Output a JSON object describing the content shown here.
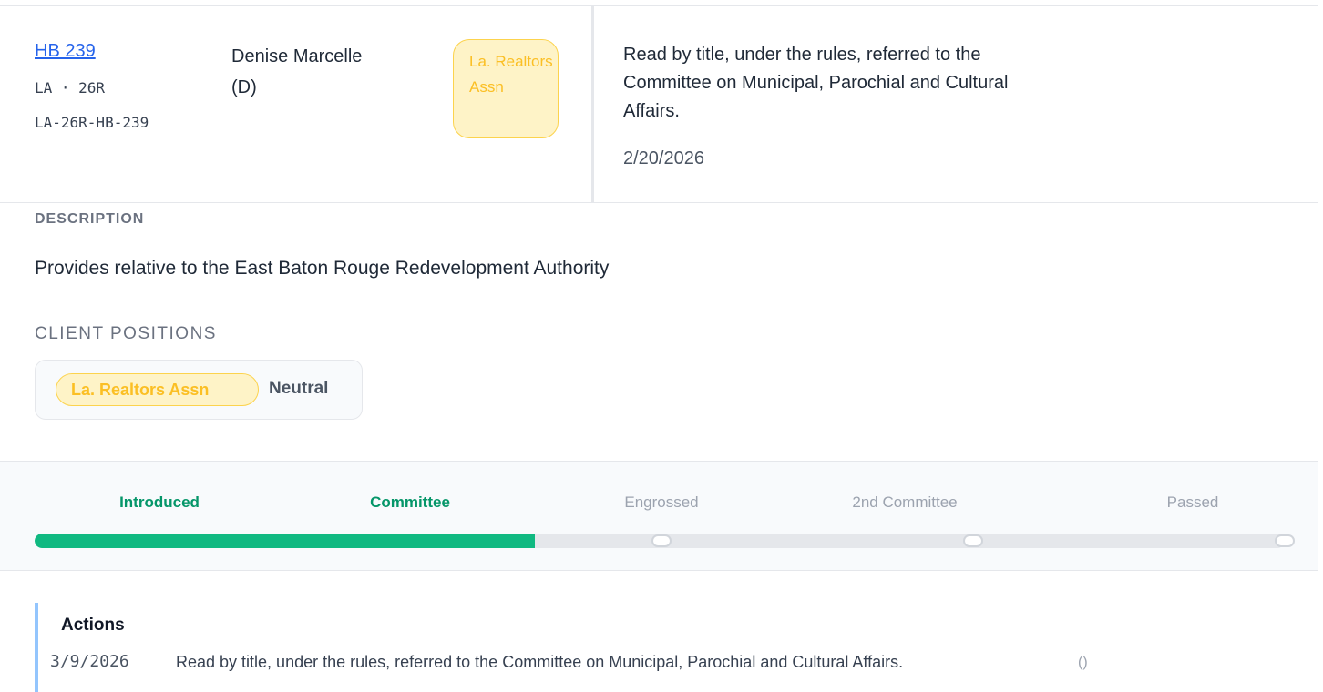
{
  "bill": {
    "number": "HB 239",
    "state_session": "LA · 26R",
    "bill_id": "LA-26R-HB-239",
    "sponsor": "Denise Marcelle (D)",
    "client_tag": "La. Realtors Assn",
    "last_action": "Read by title, under the rules, referred to the Committee on Municipal, Parochial and Cultural Affairs.",
    "last_action_date": "2/20/2026"
  },
  "description": {
    "heading": "DESCRIPTION",
    "text": "Provides relative to the East Baton Rouge Redevelopment Authority"
  },
  "client_positions": {
    "heading": "CLIENT POSITIONS",
    "items": [
      {
        "client": "La. Realtors Assn",
        "position": "Neutral"
      }
    ]
  },
  "progress": {
    "stages": [
      "Introduced",
      "Committee",
      "Engrossed",
      "2nd Committee",
      "Passed"
    ],
    "completed_stages": 2,
    "fill_fraction": 0.4,
    "colors": {
      "done": "#10b981",
      "pending": "#e5e7eb"
    }
  },
  "actions": {
    "heading": "Actions",
    "items": [
      {
        "date": "3/9/2026",
        "text": "Read by title, under the rules, referred to the Committee on Municipal, Parochial and Cultural Affairs.",
        "extra": "()"
      }
    ]
  },
  "colors": {
    "link": "#2563eb",
    "client_badge_bg": "#fef3c7",
    "client_badge_text": "#fbbf24",
    "accent_green": "#059669",
    "actions_border": "#93c5fd"
  }
}
